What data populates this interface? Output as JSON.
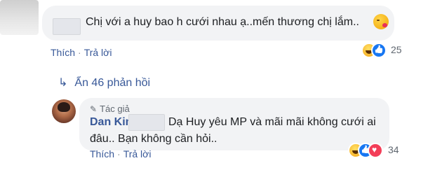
{
  "top_comment": {
    "text": "Chị với a huy bao h cưới nhau ạ..mến thương chị lắm..",
    "emoji": "kissing-heart-emoji",
    "actions": {
      "like": "Thích",
      "reply": "Trả lời"
    },
    "reactions": {
      "types": [
        "haha",
        "like"
      ],
      "count": "25"
    }
  },
  "replies_toggle": {
    "label": "Ẩn 46 phản hồi"
  },
  "reply": {
    "badge": "Tác giả",
    "author": "Dan Kim",
    "text_line1": "Dạ Huy yêu MP và mãi mãi không cưới ai",
    "text_line2": "đâu.. Bạn không cần hỏi..",
    "actions": {
      "like": "Thích",
      "reply": "Trả lời"
    },
    "reactions": {
      "types": [
        "haha",
        "like",
        "love"
      ],
      "count": "34"
    }
  },
  "colors": {
    "link": "#385898",
    "bubble": "#f2f3f5",
    "text": "#1c1e21",
    "muted": "#606770"
  }
}
